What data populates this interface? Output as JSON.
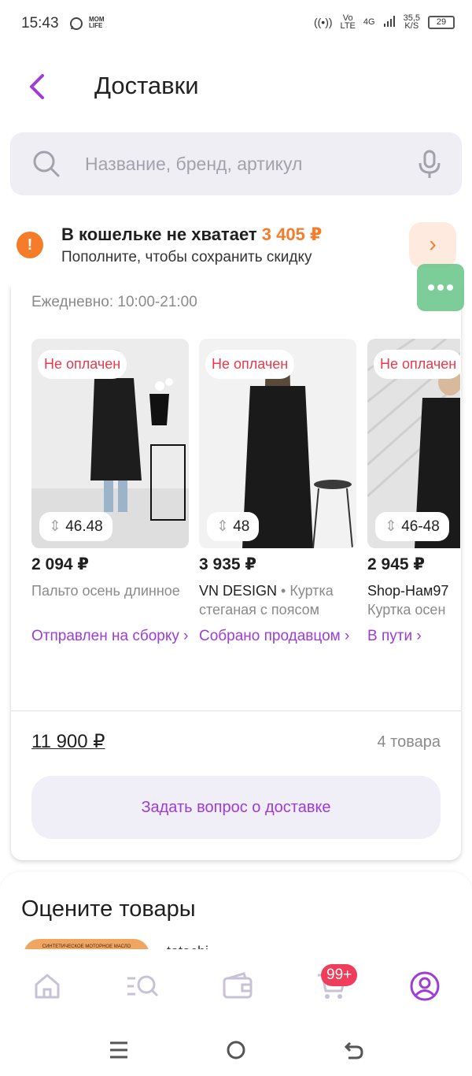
{
  "status_bar": {
    "time": "15:43",
    "net_top": "Vo",
    "net_bottom": "LTE",
    "net_4g": "4G",
    "speed_top": "35,5",
    "speed_bottom": "K/S",
    "battery": "29"
  },
  "header": {
    "title": "Доставки"
  },
  "search": {
    "placeholder": "Название, бренд, артикул"
  },
  "wallet": {
    "title": "В кошельке не хватает ",
    "amount": "3 405 ₽",
    "subtitle": "Пополните, чтобы сохранить скидку"
  },
  "delivery": {
    "hours": "Ежедневно: 10:00-21:00"
  },
  "items": [
    {
      "badge": "Не оплачен",
      "size": "46.48",
      "price": "2 094 ₽",
      "name": "Пальто осень длинное",
      "brand": "",
      "status": "Отправлен на сборку ›"
    },
    {
      "badge": "Не оплачен",
      "size": "48",
      "price": "3 935 ₽",
      "brand": "VN DESIGN",
      "name": " • Куртка стеганая с поясом",
      "status": "Собрано продавцом ›"
    },
    {
      "badge": "Не оплачен",
      "size": "46-48",
      "price": "2 945 ₽",
      "brand": "Shop-Нам97",
      "name": "Куртка осен",
      "status": "В пути ›"
    }
  ],
  "summary": {
    "total": "11 900 ₽",
    "count": "4 товара",
    "ask_button": "Задать вопрос о доставке"
  },
  "rate": {
    "title": "Оцените товары",
    "product_name": "totachi",
    "thumb_text": "СИНТЕТИЧЕСКОЕ МОТОРНОЕ МАСЛО"
  },
  "nav": {
    "cart_badge": "99+"
  },
  "colors": {
    "accent": "#9d3cd6",
    "warning": "#f57c28",
    "badge": "#e63b4c"
  }
}
